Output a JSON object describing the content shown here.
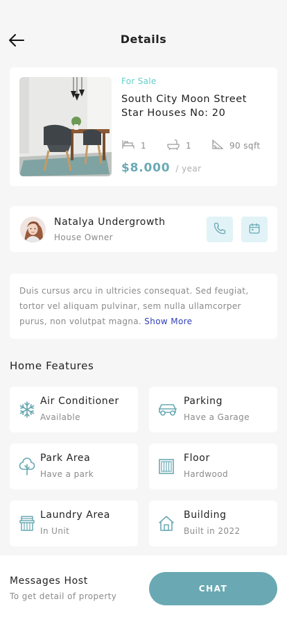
{
  "header": {
    "title": "Details"
  },
  "property": {
    "status": "For Sale",
    "name": "South City Moon Street Star Houses No: 20",
    "beds": "1",
    "baths": "1",
    "area": "90 sqft",
    "price": "$8.000",
    "period": "/ year"
  },
  "owner": {
    "name": "Natalya Undergrowth",
    "role": "House Owner"
  },
  "description": {
    "text": "Duis cursus arcu in ultricies consequat. Sed feugiat, tortor vel aliquam pulvinar, sem nulla ullamcorper purus, non volutpat magna.",
    "more": "Show More"
  },
  "features": {
    "title": "Home Features",
    "items": [
      {
        "title": "Air Conditioner",
        "sub": "Available",
        "icon": "snowflake-icon"
      },
      {
        "title": "Parking",
        "sub": "Have a Garage",
        "icon": "car-icon"
      },
      {
        "title": "Park Area",
        "sub": "Have a park",
        "icon": "tree-icon"
      },
      {
        "title": "Floor",
        "sub": "Hardwood",
        "icon": "floor-icon"
      },
      {
        "title": "Laundry Area",
        "sub": "In Unit",
        "icon": "laundry-icon"
      },
      {
        "title": "Building",
        "sub": "Built in 2022",
        "icon": "building-icon"
      }
    ]
  },
  "bottom": {
    "title": "Messages Host",
    "sub": "To get detail of property",
    "button": "CHAT"
  },
  "colors": {
    "accent": "#6aa9b3",
    "status": "#5fcfc9",
    "icon_bg": "#e2f3f7",
    "link": "#2f3fb8"
  }
}
